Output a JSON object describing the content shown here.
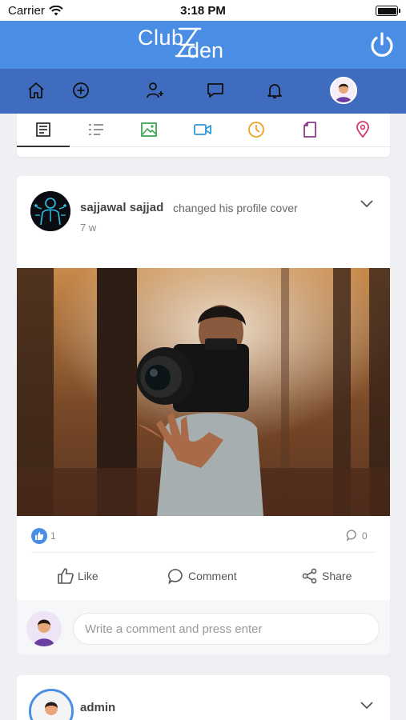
{
  "status_bar": {
    "carrier": "Carrier",
    "time": "3:18 PM"
  },
  "header": {
    "logo_text_1": "Club",
    "logo_text_2": "den",
    "logo_letter": "E"
  },
  "nav": {
    "items": [
      "home-icon",
      "add-circle-icon",
      "add-user-icon",
      "chat-icon",
      "bell-icon",
      "profile-avatar"
    ]
  },
  "composer_tabs": {
    "items": [
      {
        "icon": "status-icon",
        "color": "#333333"
      },
      {
        "icon": "list-icon",
        "color": "#888888"
      },
      {
        "icon": "image-icon",
        "color": "#3aa655"
      },
      {
        "icon": "video-icon",
        "color": "#2d9ad8"
      },
      {
        "icon": "poll-icon",
        "color": "#f0a020"
      },
      {
        "icon": "file-icon",
        "color": "#8b3a8b"
      },
      {
        "icon": "location-icon",
        "color": "#d03a6b"
      }
    ]
  },
  "post": {
    "author": "sajjawal sajjad",
    "action": "changed his profile cover",
    "time": "7 w",
    "like_count": "1",
    "comment_count": "0",
    "actions": {
      "like": "Like",
      "comment": "Comment",
      "share": "Share"
    },
    "comment_placeholder": "Write a comment and press enter"
  },
  "post2": {
    "author": "admin"
  },
  "colors": {
    "header": "#4a8de4",
    "nav": "#3f6cbf",
    "accent": "#4a8de4"
  }
}
